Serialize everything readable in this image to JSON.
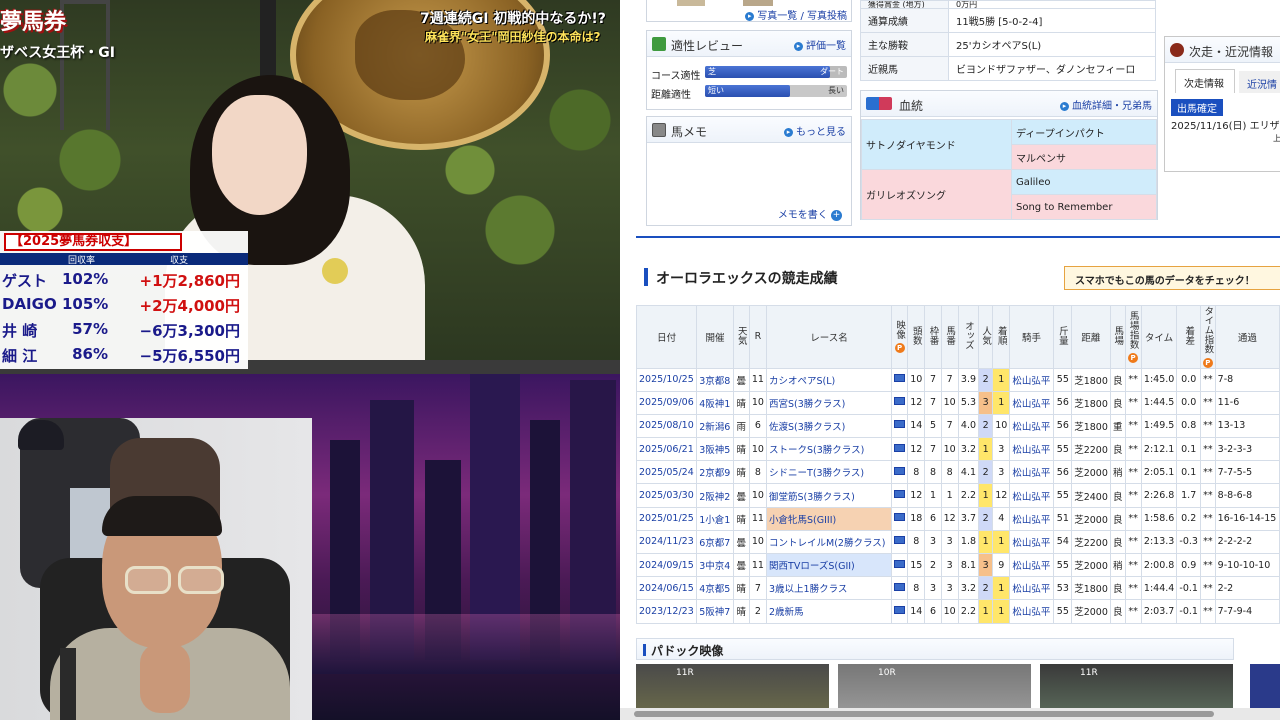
{
  "tv": {
    "show_title": "夢馬券",
    "race_subtitle": "ザベス女王杯・GI",
    "banner_line1": "7週連続GI 初戦的中なるか!?",
    "banner_line2": "麻雀界\"女王\"岡田紗佳の本命は?",
    "balance_table": {
      "title": "【2025夢馬券収支】",
      "col_rate": "回収率",
      "col_balance": "収支",
      "rows": [
        {
          "name": "ゲスト",
          "rate": "102%",
          "balance": "+1万2,860円",
          "color": "#d01010"
        },
        {
          "name": "DAIGO",
          "rate": "105%",
          "balance": "+2万4,000円",
          "color": "#d01010"
        },
        {
          "name": "井 崎",
          "rate": "57%",
          "balance": "−6万3,300円",
          "color": "#1a1a8a"
        },
        {
          "name": "細 江",
          "rate": "86%",
          "balance": "−5万6,550円",
          "color": "#1a1a8a"
        }
      ]
    }
  },
  "site": {
    "photo_links": "写真一覧 / 写真投稿",
    "aptitude": {
      "title": "適性レビュー",
      "link": "評価一覧",
      "rows": [
        {
          "label": "コース適性",
          "left": "芝",
          "right": "ダート",
          "fill": 0.88
        },
        {
          "label": "距離適性",
          "left": "短い",
          "right": "長い",
          "fill": 0.6
        }
      ]
    },
    "memo": {
      "title": "馬メモ",
      "link": "もっと見る",
      "write": "メモを書く"
    },
    "info": [
      {
        "key": "獲得賞金 (地方)",
        "value": "0万円"
      },
      {
        "key": "通算成績",
        "value": "11戦5勝 [5-0-2-4]"
      },
      {
        "key": "主な勝鞍",
        "value": "25'カシオペアS(L)"
      },
      {
        "key": "近親馬",
        "value": "ビヨンドザファザー、ダノンセフィーロ"
      }
    ],
    "pedigree": {
      "title": "血統",
      "link": "血統詳細・兄弟馬",
      "sire": "サトノダイヤモンド",
      "sire_sire": "ディープインパクト",
      "sire_dam": "マルペンサ",
      "dam": "ガリレオズソング",
      "dam_sire": "Galileo",
      "dam_dam": "Song to Remember"
    },
    "next_race": {
      "title": "次走・近況情報",
      "tab1": "次走情報",
      "tab2": "近況情",
      "badge": "出馬確定",
      "entry": "2025/11/16(日) エリザ",
      "small": "上"
    },
    "results": {
      "title": "オーロラエックスの競走成績",
      "smartphone_banner": "スマホでもこの馬のデータをチェック！",
      "headers": [
        "日付",
        "開催",
        "天気",
        "R",
        "レース名",
        "映像",
        "頭数",
        "枠番",
        "馬番",
        "オッズ",
        "人気",
        "着順",
        "騎手",
        "斤量",
        "距離",
        "馬場",
        "馬場指数",
        "タイム",
        "着差",
        "タイム指数",
        "通過"
      ],
      "rows": [
        [
          "2025/10/25",
          "3京都8",
          "曇",
          "11",
          "カシオペアS(L)",
          "10",
          "7",
          "7",
          "3.9",
          "2",
          "1",
          "松山弘平",
          "55",
          "芝1800",
          "良",
          "**",
          "1:45.0",
          "0.0",
          "**",
          "7-8"
        ],
        [
          "2025/09/06",
          "4阪神1",
          "晴",
          "10",
          "西宮S(3勝クラス)",
          "12",
          "7",
          "10",
          "5.3",
          "3",
          "1",
          "松山弘平",
          "56",
          "芝1800",
          "良",
          "**",
          "1:44.5",
          "0.0",
          "**",
          "11-6"
        ],
        [
          "2025/08/10",
          "2新潟6",
          "雨",
          "6",
          "佐渡S(3勝クラス)",
          "14",
          "5",
          "7",
          "4.0",
          "2",
          "10",
          "松山弘平",
          "56",
          "芝1800",
          "重",
          "**",
          "1:49.5",
          "0.8",
          "**",
          "13-13"
        ],
        [
          "2025/06/21",
          "3阪神5",
          "晴",
          "10",
          "ストークS(3勝クラス)",
          "12",
          "7",
          "10",
          "3.2",
          "1",
          "3",
          "松山弘平",
          "55",
          "芝2200",
          "良",
          "**",
          "2:12.1",
          "0.1",
          "**",
          "3-2-3-3"
        ],
        [
          "2025/05/24",
          "2京都9",
          "晴",
          "8",
          "シドニーT(3勝クラス)",
          "8",
          "8",
          "8",
          "4.1",
          "2",
          "3",
          "松山弘平",
          "56",
          "芝2000",
          "稍",
          "**",
          "2:05.1",
          "0.1",
          "**",
          "7-7-5-5"
        ],
        [
          "2025/03/30",
          "2阪神2",
          "曇",
          "10",
          "御堂筋S(3勝クラス)",
          "12",
          "1",
          "1",
          "2.2",
          "1",
          "12",
          "松山弘平",
          "55",
          "芝2400",
          "良",
          "**",
          "2:26.8",
          "1.7",
          "**",
          "8-8-6-8"
        ],
        [
          "2025/01/25",
          "1小倉1",
          "晴",
          "11",
          "小倉牝馬S(GIII)",
          "18",
          "6",
          "12",
          "3.7",
          "2",
          "4",
          "松山弘平",
          "51",
          "芝2000",
          "良",
          "**",
          "1:58.6",
          "0.2",
          "**",
          "16-16-14-15"
        ],
        [
          "2024/11/23",
          "6京都7",
          "曇",
          "10",
          "コントレイルM(2勝クラス)",
          "8",
          "3",
          "3",
          "1.8",
          "1",
          "1",
          "松山弘平",
          "54",
          "芝2200",
          "良",
          "**",
          "2:13.3",
          "-0.3",
          "**",
          "2-2-2-2"
        ],
        [
          "2024/09/15",
          "3中京4",
          "曇",
          "11",
          "関西TVローズS(GII)",
          "15",
          "2",
          "3",
          "8.1",
          "3",
          "9",
          "松山弘平",
          "55",
          "芝2000",
          "稍",
          "**",
          "2:00.8",
          "0.9",
          "**",
          "9-10-10-10"
        ],
        [
          "2024/06/15",
          "4京都5",
          "晴",
          "7",
          "3歳以上1勝クラス",
          "8",
          "3",
          "3",
          "3.2",
          "2",
          "1",
          "松山弘平",
          "53",
          "芝1800",
          "良",
          "**",
          "1:44.4",
          "-0.1",
          "**",
          "2-2"
        ],
        [
          "2023/12/23",
          "5阪神7",
          "晴",
          "2",
          "2歳新馬",
          "14",
          "6",
          "10",
          "2.2",
          "1",
          "1",
          "松山弘平",
          "55",
          "芝2000",
          "良",
          "**",
          "2:03.7",
          "-0.1",
          "**",
          "7-7-9-4"
        ]
      ]
    },
    "paddock": {
      "title": "パドック映像",
      "thumb_labels": [
        "11R",
        "10R",
        "11R"
      ]
    }
  }
}
